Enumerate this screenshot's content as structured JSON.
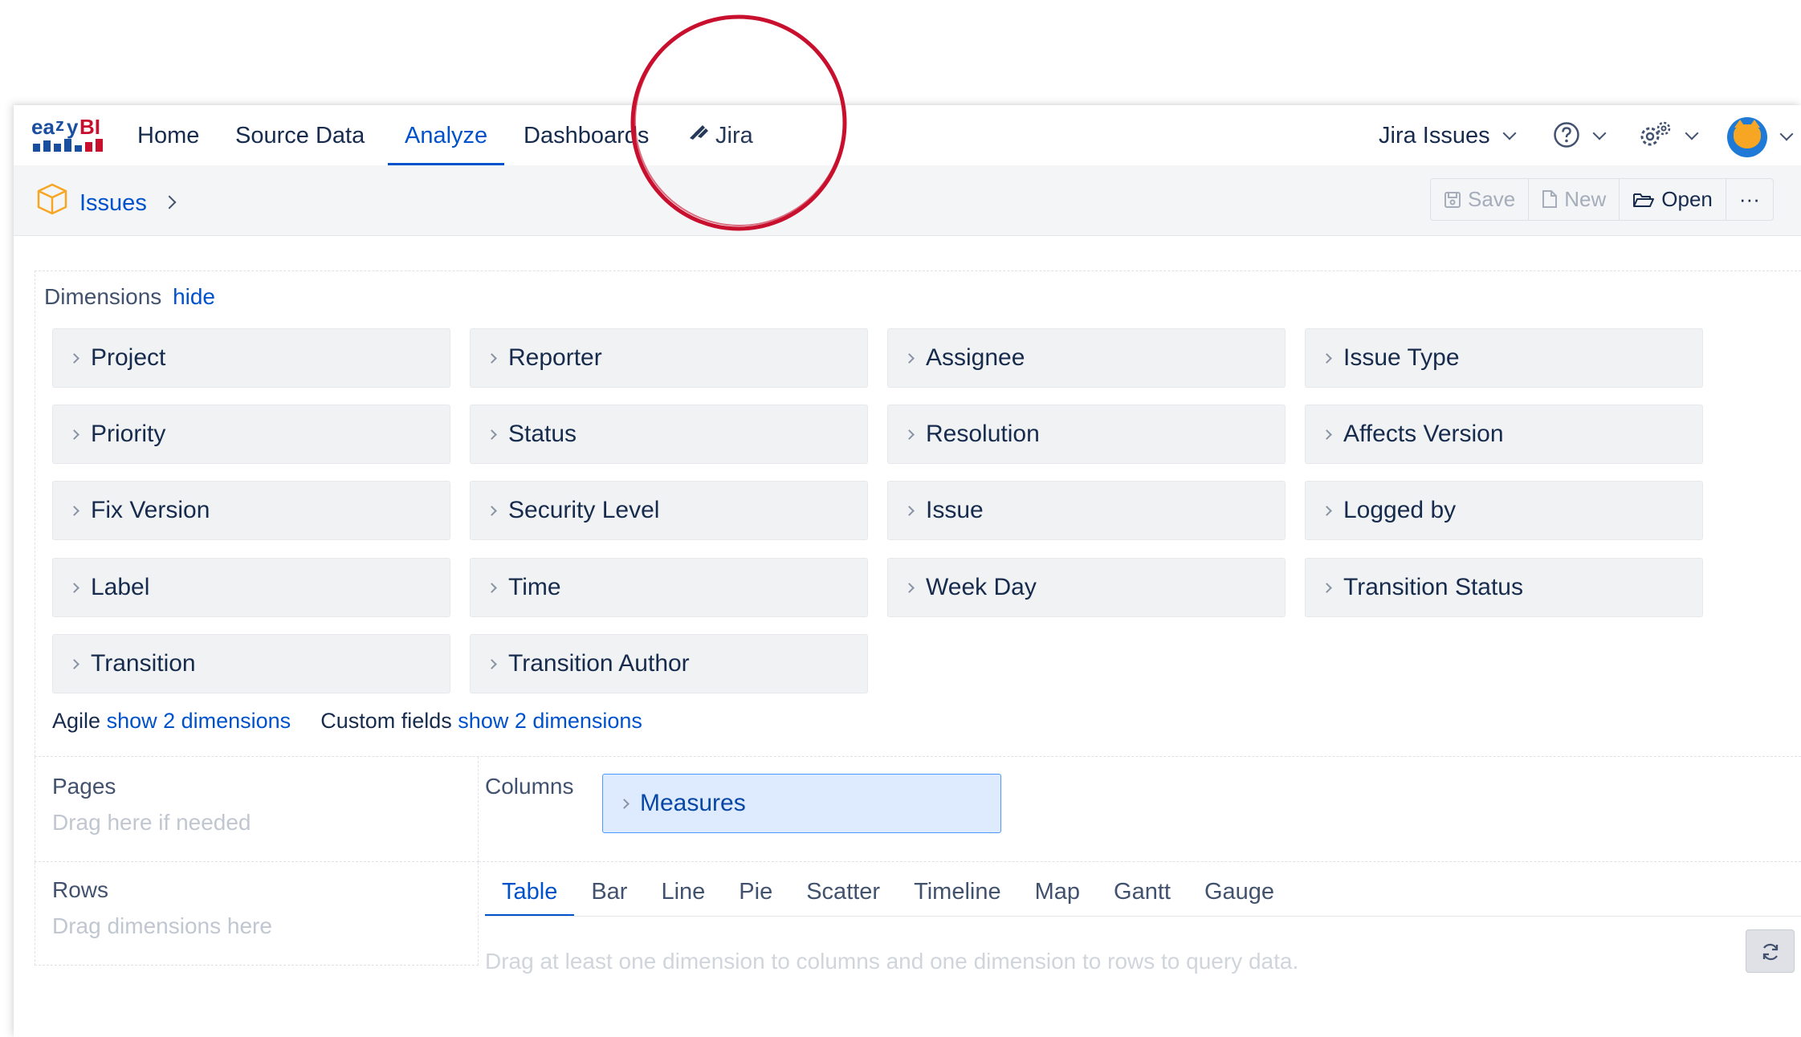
{
  "nav": {
    "logo_text": "eazyBI",
    "home": "Home",
    "source_data": "Source Data",
    "analyze": "Analyze",
    "dashboards": "Dashboards",
    "jira": "Jira",
    "account": "Jira Issues"
  },
  "breadcrumb": {
    "cube": "Issues"
  },
  "toolbar": {
    "save": "Save",
    "new": "New",
    "open": "Open",
    "more": "···"
  },
  "dimensions": {
    "title": "Dimensions",
    "hide_link": "hide",
    "items": [
      "Project",
      "Reporter",
      "Assignee",
      "Issue Type",
      "Priority",
      "Status",
      "Resolution",
      "Affects Version",
      "Fix Version",
      "Security Level",
      "Issue",
      "Logged by",
      "Label",
      "Time",
      "Week Day",
      "Transition Status",
      "Transition",
      "Transition Author"
    ],
    "agile_label": "Agile",
    "agile_link": "show 2 dimensions",
    "custom_label": "Custom fields",
    "custom_link": "show 2 dimensions"
  },
  "layout": {
    "pages_label": "Pages",
    "pages_hint": "Drag here if needed",
    "columns_label": "Columns",
    "columns_item": "Measures",
    "rows_label": "Rows",
    "rows_hint": "Drag dimensions here"
  },
  "tabs": [
    "Table",
    "Bar",
    "Line",
    "Pie",
    "Scatter",
    "Timeline",
    "Map",
    "Gantt",
    "Gauge"
  ],
  "active_tab": "Table",
  "query_hint": "Drag at least one dimension to columns and one dimension to rows to query data.",
  "colors": {
    "accent": "#0052cc",
    "annotation": "#c8102e",
    "dimension_bg": "#f0f2f3",
    "measures_bg": "#deebff"
  }
}
